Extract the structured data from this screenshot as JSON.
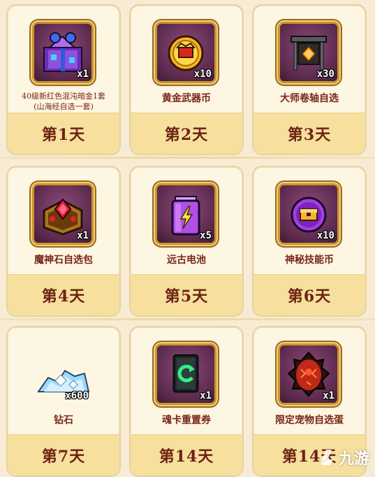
{
  "rewards": [
    {
      "name": "40级新红色混沌暗金1套\n(山海经自选一套)",
      "qty": "x1",
      "day": "第1天",
      "icon": "chaos-armor-set-icon"
    },
    {
      "name": "黄金武器币",
      "qty": "x10",
      "day": "第2天",
      "icon": "gold-weapon-coin-icon"
    },
    {
      "name": "大师卷轴自选",
      "qty": "x30",
      "day": "第3天",
      "icon": "master-scroll-icon"
    },
    {
      "name": "魔神石自选包",
      "qty": "x1",
      "day": "第4天",
      "icon": "demon-stone-pack-icon"
    },
    {
      "name": "远古电池",
      "qty": "x5",
      "day": "第5天",
      "icon": "ancient-battery-icon"
    },
    {
      "name": "神秘技能币",
      "qty": "x10",
      "day": "第6天",
      "icon": "skill-coin-icon"
    },
    {
      "name": "钻石",
      "qty": "x600",
      "day": "第7天",
      "icon": "diamond-pile-icon"
    },
    {
      "name": "魂卡重置券",
      "qty": "x1",
      "day": "第14天",
      "icon": "soul-card-reset-icon"
    },
    {
      "name": "限定宠物自选蛋",
      "qty": "x1",
      "day": "第14天",
      "icon": "pet-egg-icon"
    }
  ],
  "watermark": {
    "text": "九游",
    "logo": "9game-logo-icon"
  },
  "colors": {
    "card_bg": "#fdf6e3",
    "day_band": "#f7df9e",
    "name_text": "#7a2618",
    "frame_gold": "#c9952f",
    "frame_inner": "#5b2a49"
  }
}
